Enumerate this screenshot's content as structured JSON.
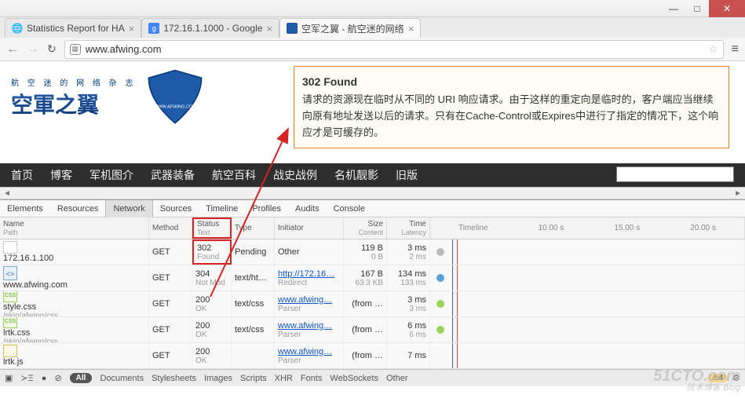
{
  "window": {
    "min": "—",
    "max": "□",
    "close": "✕"
  },
  "tabs": [
    {
      "label": "Statistics Report for HA",
      "favicon": "globe"
    },
    {
      "label": "172.16.1.1000 - Google",
      "favicon": "g"
    },
    {
      "label": "空军之翼 - 航空迷的网络",
      "favicon": "wing"
    }
  ],
  "nav": {
    "url": "www.afwing.com"
  },
  "logo": {
    "sub": "航 空 迷 的 网 络 杂 志",
    "main": "空軍之翼",
    "shield_text": "WWW.AFWING.COM"
  },
  "tooltip": {
    "title": "302 Found",
    "body": "请求的资源现在临时从不同的 URI 响应请求。由于这样的重定向是临时的，客户端应当继续向原有地址发送以后的请求。只有在Cache-Control或Expires中进行了指定的情况下，这个响应才是可缓存的。"
  },
  "sitenav": [
    "首页",
    "博客",
    "军机图介",
    "武器装备",
    "航空百科",
    "战史战例",
    "名机靓影",
    "旧版"
  ],
  "devtools": {
    "tabs": [
      "Elements",
      "Resources",
      "Network",
      "Sources",
      "Timeline",
      "Profiles",
      "Audits",
      "Console"
    ],
    "active_tab": 2,
    "columns": {
      "name": {
        "h": "Name",
        "s": "Path"
      },
      "method": {
        "h": "Method",
        "s": ""
      },
      "status": {
        "h": "Status",
        "s": "Text"
      },
      "type": {
        "h": "Type",
        "s": ""
      },
      "initiator": {
        "h": "Initiator",
        "s": ""
      },
      "size": {
        "h": "Size",
        "s": "Content"
      },
      "time": {
        "h": "Time",
        "s": "Latency"
      },
      "timeline": {
        "h": "Timeline",
        "s": ""
      }
    },
    "timeline_ticks": [
      "10.00 s",
      "15.00 s",
      "20.00 s"
    ],
    "rows": [
      {
        "icon": "blank",
        "name": "172.16.1.100",
        "path": "",
        "method": "GET",
        "status": "302",
        "statusText": "Found",
        "type": "Pending",
        "initiator": "Other",
        "initSub": "",
        "size": "119 B",
        "sizeSub": "0 B",
        "time": "3 ms",
        "timeSub": "2 ms",
        "dot": "#bbb",
        "hl": true
      },
      {
        "icon": "html",
        "name": "www.afwing.com",
        "path": "",
        "method": "GET",
        "status": "304",
        "statusText": "Not Mod",
        "type": "text/ht…",
        "initiator": "http://172.16…",
        "initSub": "Redirect",
        "size": "167 B",
        "sizeSub": "63.3 KB",
        "time": "134 ms",
        "timeSub": "133 ms",
        "dot": "#5aa0d8",
        "link": true
      },
      {
        "icon": "css",
        "name": "style.css",
        "path": "/skin/afwing/css",
        "method": "GET",
        "status": "200",
        "statusText": "OK",
        "type": "text/css",
        "initiator": "www.afwing…",
        "initSub": "Parser",
        "size": "(from …",
        "sizeSub": "",
        "time": "3 ms",
        "timeSub": "3 ms",
        "dot": "#9ad45a",
        "link": true
      },
      {
        "icon": "css",
        "name": "lrtk.css",
        "path": "/skin/afwing/css",
        "method": "GET",
        "status": "200",
        "statusText": "OK",
        "type": "text/css",
        "initiator": "www.afwing…",
        "initSub": "Parser",
        "size": "(from …",
        "sizeSub": "",
        "time": "6 ms",
        "timeSub": "6 ms",
        "dot": "#9ad45a",
        "link": true
      },
      {
        "icon": "js",
        "name": "lrtk.js",
        "path": "",
        "method": "GET",
        "status": "200",
        "statusText": "OK",
        "type": "",
        "initiator": "www.afwing…",
        "initSub": "Parser",
        "size": "(from …",
        "sizeSub": "",
        "time": "7 ms",
        "timeSub": "",
        "dot": "",
        "link": true
      }
    ],
    "footer": {
      "filters": [
        "All",
        "Documents",
        "Stylesheets",
        "Images",
        "Scripts",
        "XHR",
        "Fonts",
        "WebSockets",
        "Other"
      ],
      "active_filter": 0,
      "warn_count": "4"
    }
  },
  "watermark": {
    "big": "51CTO.com",
    "small": "技术博客  Blog"
  }
}
